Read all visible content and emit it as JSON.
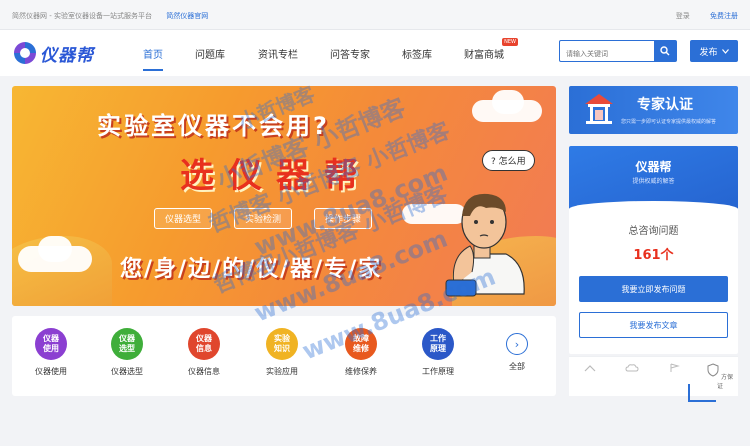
{
  "topbar": {
    "intro": "简然仪器网 - 实验室仪器设备一站式服务平台",
    "official_link": "简然仪器官网",
    "login": "登录",
    "register": "免费注册"
  },
  "header": {
    "logo_text": "仪器帮",
    "nav": [
      {
        "label": "首页",
        "active": true
      },
      {
        "label": "问题库"
      },
      {
        "label": "资讯专栏"
      },
      {
        "label": "问答专家"
      },
      {
        "label": "标签库"
      },
      {
        "label": "财富商城",
        "badge": "NEW"
      }
    ],
    "search_placeholder": "请输入关键词",
    "publish_label": "发布"
  },
  "banner": {
    "line1": "实验室仪器不会用?",
    "line2": "选仪器帮",
    "tags": [
      "仪器选型",
      "实验检测",
      "操作步骤"
    ],
    "line3": "您/身/边/的/仪/器/专/家",
    "bubble": "? 怎么用"
  },
  "categories": [
    {
      "icon_text": "仪器\n使用",
      "label": "仪器使用",
      "color": "#8b3fd1"
    },
    {
      "icon_text": "仪器\n选型",
      "label": "仪器选型",
      "color": "#3fae3a"
    },
    {
      "icon_text": "仪器\n信息",
      "label": "仪器信息",
      "color": "#e0462d"
    },
    {
      "icon_text": "实验\n知识",
      "label": "实验应用",
      "color": "#f0b323"
    },
    {
      "icon_text": "故障\n维修",
      "label": "维修保养",
      "color": "#e8591e"
    },
    {
      "icon_text": "工作\n原理",
      "label": "工作原理",
      "color": "#2b58c8"
    }
  ],
  "categories_more": "全部",
  "expert": {
    "title": "专家认证",
    "subtitle": "您只需一步即可认证专家提供最权威的解答"
  },
  "card": {
    "title": "仪器帮",
    "subtitle": "提供权威的解答",
    "count_label": "总咨询问题",
    "count": "161个",
    "btn_primary": "我要立即发布问题",
    "btn_secondary": "我要发布文章"
  },
  "strip": {
    "assure": "方保证"
  },
  "watermarks": [
    "小哲博客",
    "小哲博客 小哲博客",
    "哲博客 小哲博客 小哲博客",
    "www.8ua8.com",
    "哲博客小哲博客 小哲博客",
    "www.8ua8.com",
    "www.8ua8.com"
  ]
}
